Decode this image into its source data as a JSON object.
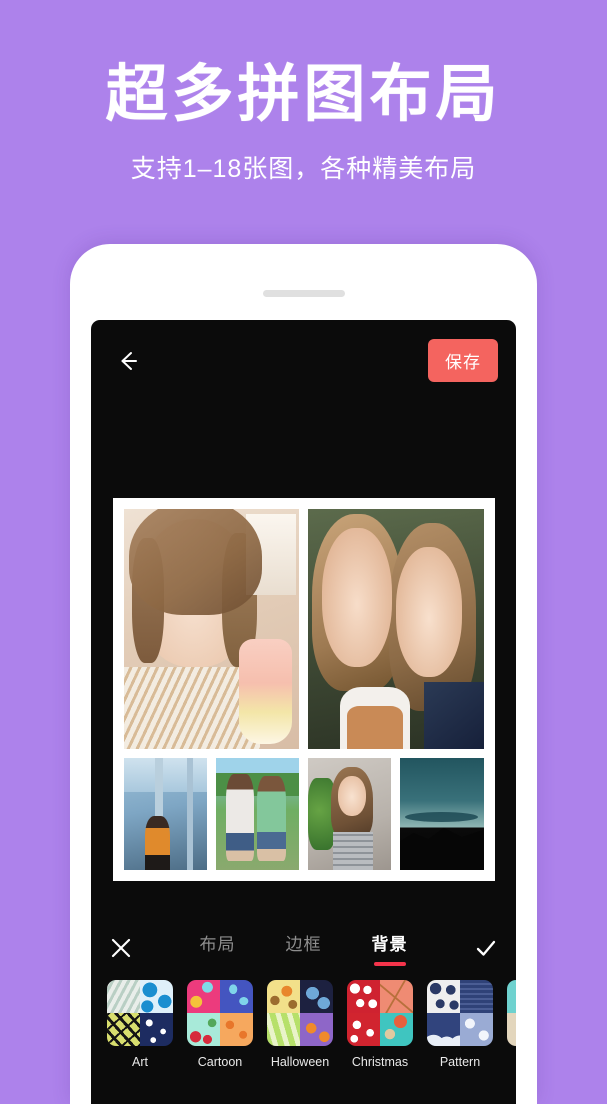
{
  "promo": {
    "title": "超多拼图布局",
    "subtitle": "支持1–18张图，各种精美布局"
  },
  "colors": {
    "background": "#ad82eb",
    "save_button": "#f4645f",
    "active_tab_underline": "#f4344b",
    "screen": "#0b0b0b",
    "collage_border": "#ffffff"
  },
  "app": {
    "topbar": {
      "back_icon": "arrow-left-icon",
      "save_label": "保存"
    },
    "collage": {
      "photo_count": 6,
      "rows": [
        {
          "cells": [
            {
              "name": "photo-girl-with-drink",
              "alt": "女孩与饮品"
            },
            {
              "name": "photo-two-girls-outdoor",
              "alt": "户外双人自拍"
            }
          ]
        },
        {
          "cells": [
            {
              "name": "photo-street-blue",
              "alt": "蓝色街景"
            },
            {
              "name": "photo-girls-sunglasses",
              "alt": "戴墨镜的两位女孩"
            },
            {
              "name": "photo-girl-grey-top",
              "alt": "灰色上衣女孩"
            },
            {
              "name": "photo-mountain-night",
              "alt": "夜色山景"
            }
          ]
        }
      ]
    },
    "toolbar": {
      "close_icon": "close-icon",
      "confirm_icon": "check-icon",
      "tabs": [
        {
          "label": "布局",
          "active": false
        },
        {
          "label": "边框",
          "active": false
        },
        {
          "label": "背景",
          "active": true
        }
      ]
    },
    "backgrounds": {
      "items": [
        {
          "label": "Art"
        },
        {
          "label": "Cartoon"
        },
        {
          "label": "Halloween"
        },
        {
          "label": "Christmas"
        },
        {
          "label": "Pattern"
        },
        {
          "label": ""
        }
      ]
    }
  }
}
